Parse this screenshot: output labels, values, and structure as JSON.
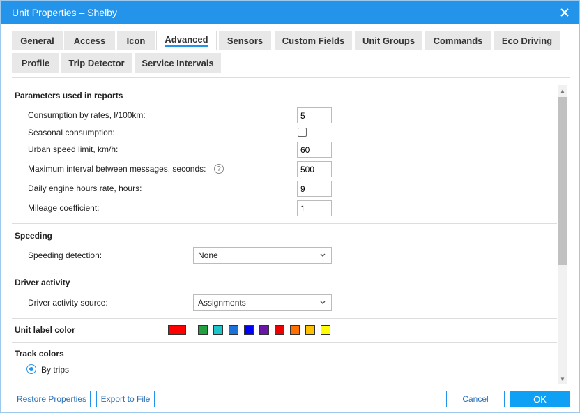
{
  "window": {
    "title": "Unit Properties – Shelby"
  },
  "tabs": [
    {
      "label": "General"
    },
    {
      "label": "Access"
    },
    {
      "label": "Icon"
    },
    {
      "label": "Advanced",
      "active": true
    },
    {
      "label": "Sensors"
    },
    {
      "label": "Custom Fields"
    },
    {
      "label": "Unit Groups"
    },
    {
      "label": "Commands"
    },
    {
      "label": "Eco Driving"
    },
    {
      "label": "Profile"
    },
    {
      "label": "Trip Detector"
    },
    {
      "label": "Service Intervals"
    }
  ],
  "reports": {
    "title": "Parameters used in reports",
    "consumption_label": "Consumption by rates, l/100km:",
    "consumption_value": "5",
    "seasonal_label": "Seasonal consumption:",
    "seasonal_checked": false,
    "urban_label": "Urban speed limit, km/h:",
    "urban_value": "60",
    "interval_label": "Maximum interval between messages, seconds:",
    "interval_help": "?",
    "interval_value": "500",
    "engine_label": "Daily engine hours rate, hours:",
    "engine_value": "9",
    "mileage_label": "Mileage coefficient:",
    "mileage_value": "1"
  },
  "speeding": {
    "title": "Speeding",
    "detection_label": "Speeding detection:",
    "detection_value": "None"
  },
  "driver": {
    "title": "Driver activity",
    "source_label": "Driver activity source:",
    "source_value": "Assignments"
  },
  "label_color": {
    "title": "Unit label color",
    "selected": "#ff0000",
    "palette": [
      "#22a03f",
      "#1dc4cb",
      "#1d72d9",
      "#0000ff",
      "#6a17a8",
      "#ee0000",
      "#ff7000",
      "#ffc000",
      "#ffff00"
    ]
  },
  "track_colors": {
    "title": "Track colors",
    "option_label": "By trips"
  },
  "footer": {
    "restore_label": "Restore Properties",
    "export_label": "Export to File",
    "cancel_label": "Cancel",
    "ok_label": "OK"
  },
  "colors": {
    "accent": "#2494eb",
    "ok_button": "#0ea0f4"
  },
  "icons": {
    "close": "close-icon",
    "help": "help-icon",
    "dropdown": "chevron-down-icon"
  }
}
